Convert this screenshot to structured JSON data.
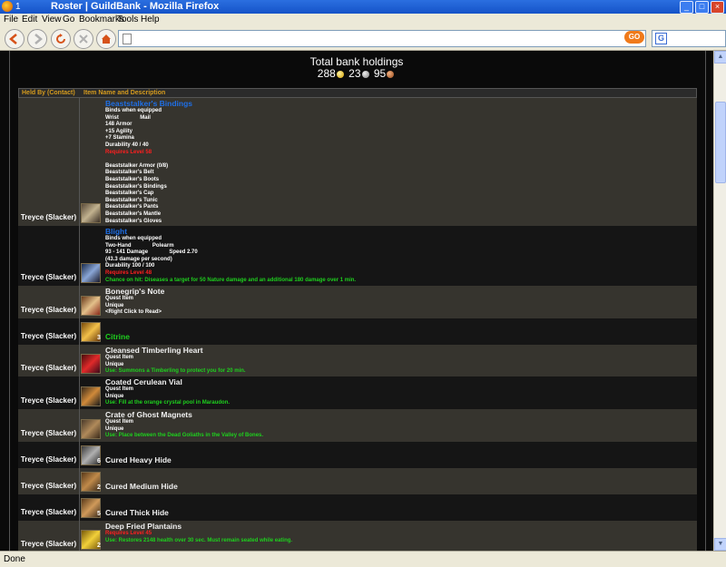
{
  "window": {
    "title": "Roster | GuildBank - Mozilla Firefox",
    "tab_number": "1"
  },
  "menu": [
    "File",
    "Edit",
    "View",
    "Go",
    "Bookmarks",
    "Tools",
    "Help"
  ],
  "toolbar": {
    "go_label": "GO",
    "search_letter": "G",
    "url": ""
  },
  "status": "Done",
  "bank": {
    "title": "Total bank holdings",
    "gold": "288",
    "silver": "23",
    "copper": "95"
  },
  "table": {
    "headers": [
      "Held By (Contact)",
      "Item Name and Description"
    ],
    "rows": [
      {
        "held_by": "Treyce (Slacker)",
        "name": "Beaststalker's Bindings",
        "quality": "blue",
        "stack": "",
        "lines": [
          "Binds when equipped",
          "Wrist              Mail",
          "148 Armor",
          "+15 Agility",
          "+7 Stamina",
          "Durability 40 / 40"
        ],
        "requires": "Requires Level 58",
        "set_lines": [
          "",
          "Beaststalker Armor (0/8)",
          "Beaststalker's Belt",
          "Beaststalker's Boots",
          "Beaststalker's Bindings",
          "Beaststalker's Cap",
          "Beaststalker's Tunic",
          "Beaststalker's Pants",
          "Beaststalker's Mantle",
          "Beaststalker's Gloves"
        ],
        "use": ""
      },
      {
        "held_by": "Treyce (Slacker)",
        "name": "Blight",
        "quality": "blue",
        "stack": "",
        "lines": [
          "Binds when equipped",
          "Two-Hand              Polearm",
          "93 - 141 Damage              Speed 2.70",
          "(43.3 damage per second)",
          "Durability 100 / 100"
        ],
        "requires": "Requires Level 48",
        "set_lines": [],
        "use": "Chance on hit: Diseases a target for 50 Nature damage and an additional 180 damage over 1 min."
      },
      {
        "held_by": "Treyce (Slacker)",
        "name": "Bonegrip's Note",
        "quality": "white",
        "stack": "",
        "lines": [
          "Quest Item",
          "Unique",
          "<Right Click to Read>"
        ],
        "requires": "",
        "set_lines": [],
        "use": ""
      },
      {
        "held_by": "Treyce (Slacker)",
        "name": "Citrine",
        "quality": "green",
        "stack": "3",
        "lines": [],
        "requires": "",
        "set_lines": [],
        "use": ""
      },
      {
        "held_by": "Treyce (Slacker)",
        "name": "Cleansed Timberling Heart",
        "quality": "white",
        "stack": "",
        "lines": [
          "Quest Item",
          "Unique"
        ],
        "requires": "",
        "set_lines": [],
        "use": "Use: Summons a Timberling to protect you for 20 min."
      },
      {
        "held_by": "Treyce (Slacker)",
        "name": "Coated Cerulean Vial",
        "quality": "white",
        "stack": "",
        "lines": [
          "Quest Item",
          "Unique"
        ],
        "requires": "",
        "set_lines": [],
        "use": "Use: Fill at the orange crystal pool in Maraudon."
      },
      {
        "held_by": "Treyce (Slacker)",
        "name": "Crate of Ghost Magnets",
        "quality": "white",
        "stack": "",
        "lines": [
          "Quest Item",
          "Unique"
        ],
        "requires": "",
        "set_lines": [],
        "use": "Use: Place between the Dead Goliaths in the Valley of Bones."
      },
      {
        "held_by": "Treyce (Slacker)",
        "name": "Cured Heavy Hide",
        "quality": "white",
        "stack": "6",
        "lines": [],
        "requires": "",
        "set_lines": [],
        "use": ""
      },
      {
        "held_by": "Treyce (Slacker)",
        "name": "Cured Medium Hide",
        "quality": "white",
        "stack": "2",
        "lines": [],
        "requires": "",
        "set_lines": [],
        "use": ""
      },
      {
        "held_by": "Treyce (Slacker)",
        "name": "Cured Thick Hide",
        "quality": "white",
        "stack": "5",
        "lines": [],
        "requires": "",
        "set_lines": [],
        "use": ""
      },
      {
        "held_by": "Treyce (Slacker)",
        "name": "Deep Fried Plantains",
        "quality": "white",
        "stack": "2",
        "lines": [],
        "requires": "Requires Level 45",
        "set_lines": [],
        "use": "Use: Restores 2148 health over 30 sec. Must remain seated while eating."
      }
    ]
  }
}
